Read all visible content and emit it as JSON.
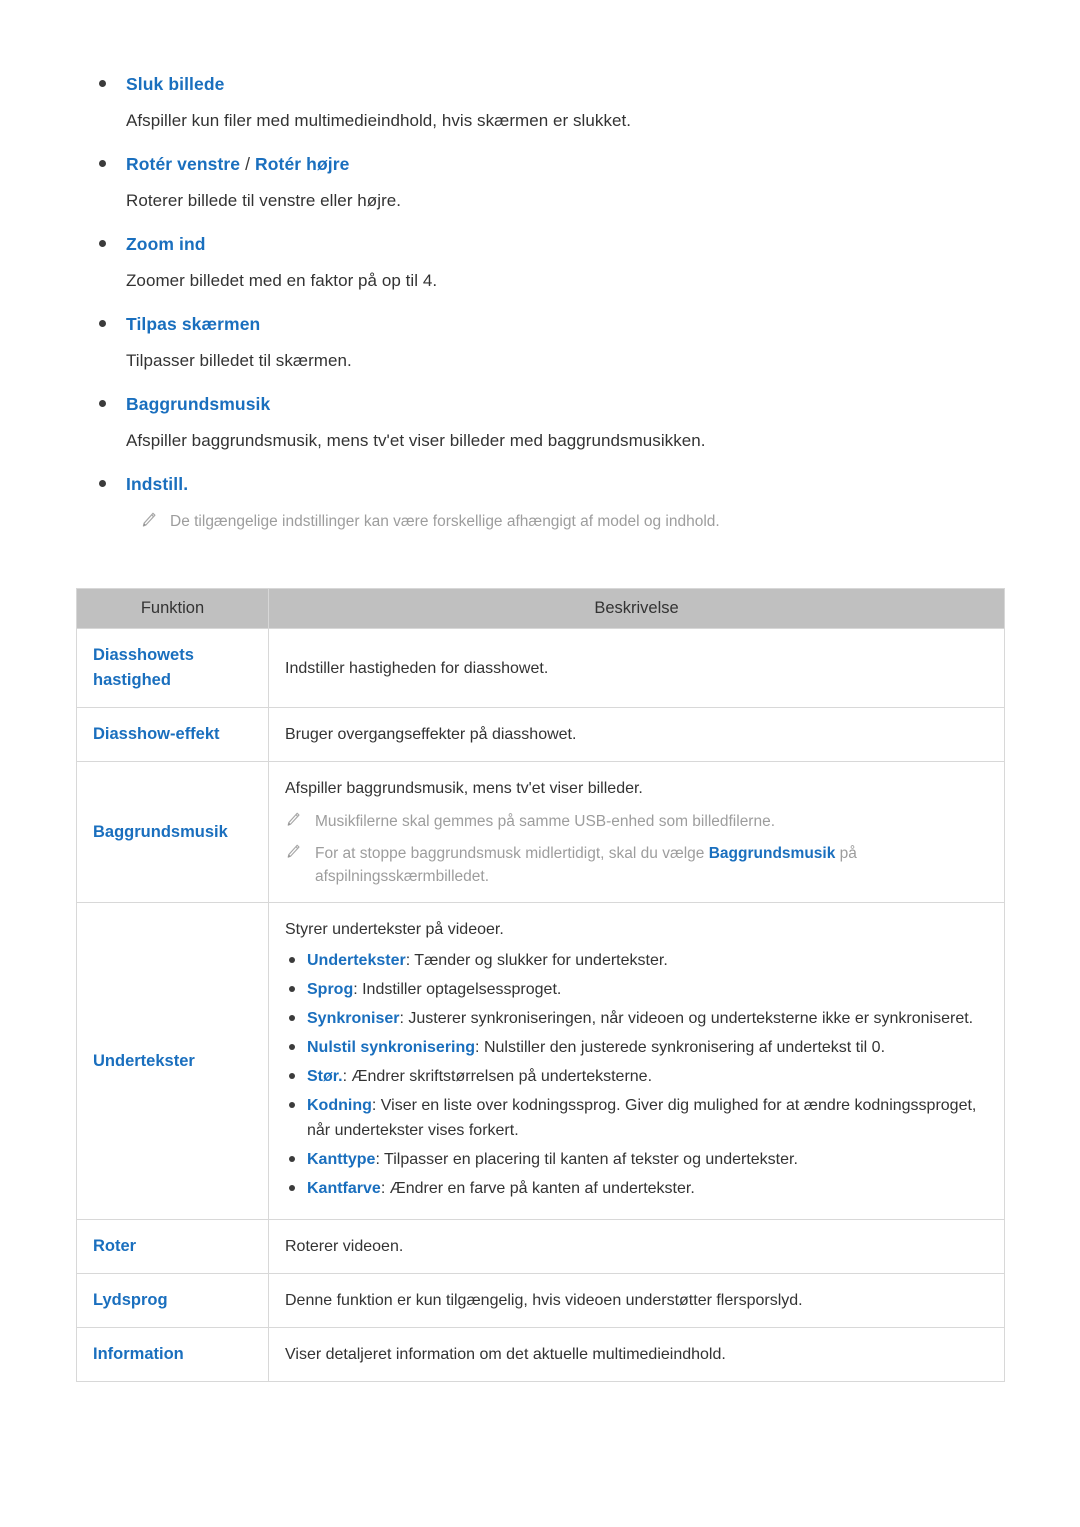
{
  "colors": {
    "accent_blue": "#1a6fbe",
    "body_text": "#333333",
    "note_gray": "#9d9d9d",
    "table_header_bg": "#c0c0c0",
    "table_border": "#d8d8d8"
  },
  "features": [
    {
      "title": "Sluk billede",
      "title_parts": [
        {
          "text": "Sluk billede",
          "style": "link"
        }
      ],
      "description": "Afspiller kun filer med multimedieindhold, hvis skærmen er slukket."
    },
    {
      "title": "Rotér venstre / Rotér højre",
      "title_parts": [
        {
          "text": "Rotér venstre",
          "style": "link"
        },
        {
          "text": " / ",
          "style": "separator"
        },
        {
          "text": "Rotér højre",
          "style": "link"
        }
      ],
      "description": "Roterer billede til venstre eller højre."
    },
    {
      "title": "Zoom ind",
      "title_parts": [
        {
          "text": "Zoom ind",
          "style": "link"
        }
      ],
      "description": "Zoomer billedet med en faktor på op til 4."
    },
    {
      "title": "Tilpas skærmen",
      "title_parts": [
        {
          "text": "Tilpas skærmen",
          "style": "link"
        }
      ],
      "description": "Tilpasser billedet til skærmen."
    },
    {
      "title": "Baggrundsmusik",
      "title_parts": [
        {
          "text": "Baggrundsmusik",
          "style": "link"
        }
      ],
      "description": "Afspiller baggrundsmusik, mens tv'et viser billeder med baggrundsmusikken."
    },
    {
      "title": "Indstill.",
      "title_parts": [
        {
          "text": "Indstill.",
          "style": "link"
        }
      ],
      "description": ""
    }
  ],
  "page_note": {
    "icon": "pencil-icon",
    "text": "De tilgængelige indstillinger kan være forskellige afhængigt af model og indhold."
  },
  "table": {
    "headers": [
      "Funktion",
      "Beskrivelse"
    ],
    "rows": [
      {
        "function": "Diasshowets hastighed",
        "description": "Indstiller hastigheden for diasshowet."
      },
      {
        "function": "Diasshow-effekt",
        "description": "Bruger overgangseffekter på diasshowet."
      },
      {
        "function": "Baggrundsmusik",
        "description": "Afspiller baggrundsmusik, mens tv'et viser billeder.",
        "notes": [
          {
            "icon": "pencil-icon",
            "segments": [
              {
                "text": "Musikfilerne skal gemmes på samme USB-enhed som billedfilerne.",
                "style": "plain"
              }
            ]
          },
          {
            "icon": "pencil-icon",
            "segments": [
              {
                "text": "For at stoppe baggrundsmusk midlertidigt, skal du vælge ",
                "style": "plain"
              },
              {
                "text": "Baggrundsmusik",
                "style": "strong-link"
              },
              {
                "text": " på afspilningsskærmbilledet.",
                "style": "plain"
              }
            ]
          }
        ]
      },
      {
        "function": "Undertekster",
        "description": "Styrer undertekster på videoer.",
        "bullets": [
          {
            "term": "Undertekster",
            "text": ": Tænder og slukker for undertekster."
          },
          {
            "term": "Sprog",
            "text": ": Indstiller optagelsessproget."
          },
          {
            "term": "Synkroniser",
            "text": ": Justerer synkroniseringen, når videoen og underteksterne ikke er synkroniseret."
          },
          {
            "term": "Nulstil synkronisering",
            "text": ": Nulstiller den justerede synkronisering af undertekst til 0."
          },
          {
            "term": "Stør.",
            "text": ": Ændrer skriftstørrelsen på underteksterne."
          },
          {
            "term": "Kodning",
            "text": ": Viser en liste over kodningssprog. Giver dig mulighed for at ændre kodningssproget, når undertekster vises forkert."
          },
          {
            "term": "Kanttype",
            "text": ": Tilpasser en placering til kanten af tekster og undertekster."
          },
          {
            "term": "Kantfarve",
            "text": ": Ændrer en farve på kanten af undertekster."
          }
        ]
      },
      {
        "function": "Roter",
        "description": "Roterer videoen."
      },
      {
        "function": "Lydsprog",
        "description": "Denne funktion er kun tilgængelig, hvis videoen understøtter flersporslyd."
      },
      {
        "function": "Information",
        "description": "Viser detaljeret information om det aktuelle multimedieindhold."
      }
    ]
  }
}
